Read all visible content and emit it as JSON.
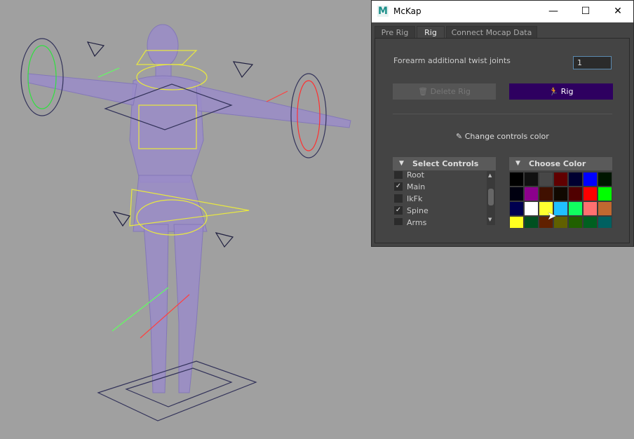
{
  "window": {
    "title": "McKap",
    "logo": "M",
    "minimize": "—",
    "maximize": "☐",
    "close": "✕"
  },
  "tabs": [
    {
      "label": "Pre Rig"
    },
    {
      "label": "Rig",
      "active": true
    },
    {
      "label": "Connect Mocap Data"
    }
  ],
  "rig": {
    "twist_label": "Forearm additional twist joints",
    "twist_value": "1",
    "delete_label": "Delete Rig",
    "rig_label": "Rig",
    "rig_color": "#2e0060",
    "change_color_label": "Change controls color"
  },
  "select_controls": {
    "header": "Select Controls",
    "items": [
      {
        "label": "Root",
        "checked": false
      },
      {
        "label": "Main",
        "checked": true
      },
      {
        "label": "IkFk",
        "checked": false
      },
      {
        "label": "Spine",
        "checked": true
      },
      {
        "label": "Arms",
        "checked": false
      }
    ]
  },
  "choose_color": {
    "header": "Choose Color",
    "colors": [
      "#000000",
      "#111111",
      "#474747",
      "#600000",
      "#000030",
      "#0000ff",
      "#001600",
      "#000010",
      "#8c008c",
      "#401000",
      "#100800",
      "#500000",
      "#ff0000",
      "#00ff00",
      "#000050",
      "#ffffff",
      "#ffff30",
      "#20c0ff",
      "#10ff60",
      "#ff7070",
      "#c06830",
      "#ffff20",
      "#005020",
      "#602000",
      "#606000",
      "#206000",
      "#006020",
      "#006060"
    ]
  }
}
